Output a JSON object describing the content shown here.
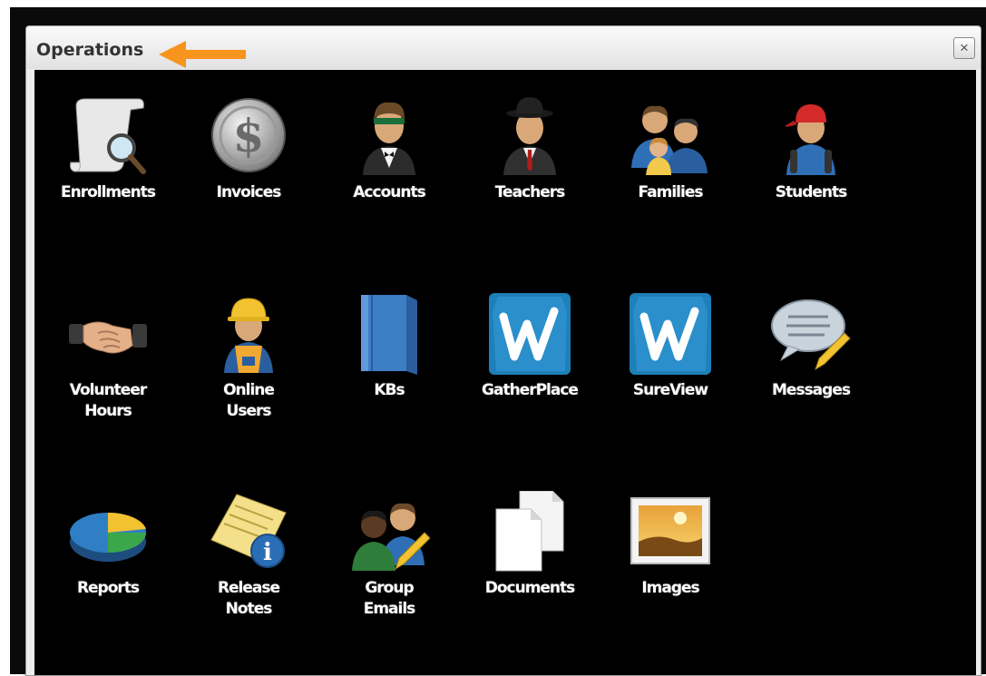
{
  "window": {
    "title": "Operations",
    "close_label": "×"
  },
  "items": {
    "enrollments": "Enrollments",
    "invoices": "Invoices",
    "accounts": "Accounts",
    "teachers": "Teachers",
    "families": "Families",
    "students": "Students",
    "volunteer_hours": "Volunteer\nHours",
    "online_users": "Online\nUsers",
    "kbs": "KBs",
    "gatherplace": "GatherPlace",
    "sureview": "SureView",
    "messages": "Messages",
    "reports": "Reports",
    "release_notes": "Release\nNotes",
    "group_emails": "Group\nEmails",
    "documents": "Documents",
    "images": "Images"
  },
  "icons": {
    "enrollments": "scroll-magnifier-icon",
    "invoices": "dollar-coin-icon",
    "accounts": "accountant-icon",
    "teachers": "teacher-icon",
    "families": "family-icon",
    "students": "student-icon",
    "volunteer_hours": "handshake-icon",
    "online_users": "worker-icon",
    "kbs": "book-icon",
    "gatherplace": "gatherplace-icon",
    "sureview": "sureview-icon",
    "messages": "message-bubble-icon",
    "reports": "pie-chart-icon",
    "release_notes": "notes-info-icon",
    "group_emails": "group-email-icon",
    "documents": "documents-icon",
    "images": "image-icon"
  },
  "colors": {
    "accent_arrow": "#f7941d",
    "background": "#000000",
    "titlebar": "#ececec"
  }
}
